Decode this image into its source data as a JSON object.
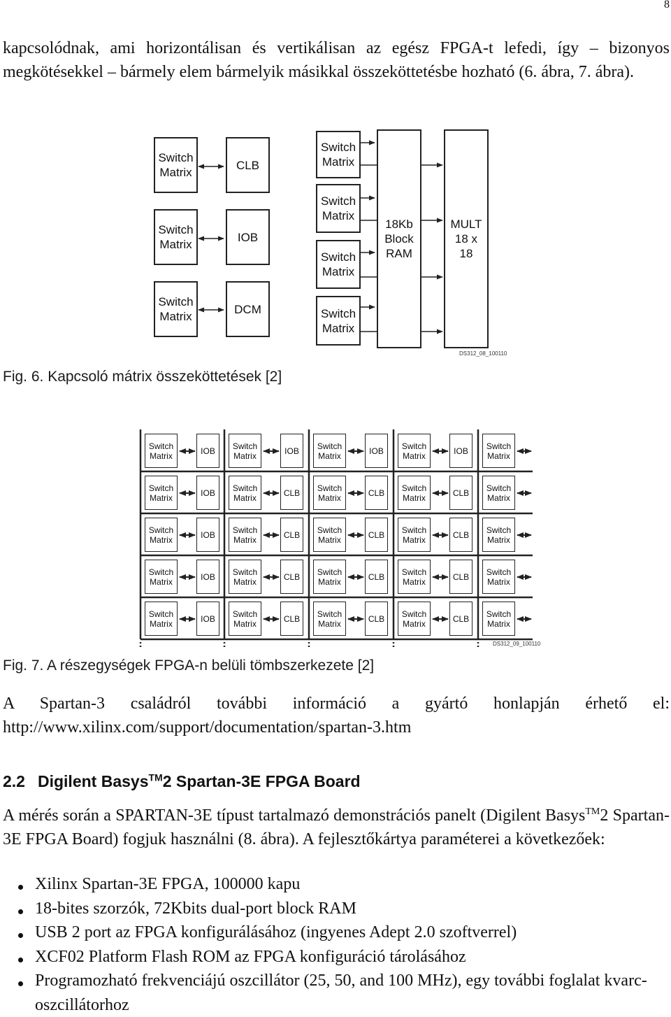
{
  "page": {
    "number": "8",
    "intro_paragraph": "kapcsolódnak, ami horizontálisan és vertikálisan az egész FPGA-t lefedi, így – bizonyos megkötésekkel – bármely elem bármelyik másikkal összeköttetésbe hozható (6. ábra, 7. ábra)."
  },
  "figure6": {
    "caption": "Fig. 6. Kapcsoló mátrix összeköttetések [2]",
    "tag": "DS312_08_100110",
    "left_pairs": [
      {
        "switch": "Switch Matrix",
        "block": "CLB"
      },
      {
        "switch": "Switch Matrix",
        "block": "IOB"
      },
      {
        "switch": "Switch Matrix",
        "block": "DCM"
      }
    ],
    "right_switches": [
      "Switch Matrix",
      "Switch Matrix",
      "Switch Matrix",
      "Switch Matrix"
    ],
    "ram_label": "18Kb Block RAM",
    "mult_label": "MULT 18 x 18"
  },
  "figure7": {
    "caption": "Fig. 7. A részegységek FPGA-n belüli tömbszerkezete [2]",
    "tag": "DS312_09_100110",
    "switch_label": "Switch Matrix",
    "rows": [
      [
        "IOB",
        "IOB",
        "IOB",
        "IOB"
      ],
      [
        "IOB",
        "CLB",
        "CLB",
        "CLB"
      ],
      [
        "IOB",
        "CLB",
        "CLB",
        "CLB"
      ],
      [
        "IOB",
        "CLB",
        "CLB",
        "CLB"
      ],
      [
        "IOB",
        "CLB",
        "CLB",
        "CLB"
      ]
    ]
  },
  "info": {
    "text": "A Spartan-3 családról további információ a gyártó honlapján érhető el:",
    "url": "http://www.xilinx.com/support/documentation/spartan-3.htm"
  },
  "section": {
    "number": "2.2",
    "title_pre": "Digilent Basys",
    "title_sup": "TM",
    "title_post": "2 Spartan-3E FPGA Board",
    "para_pre": "A mérés során a SPARTAN-3E típust tartalmazó demonstrációs panelt (Digilent Basys",
    "para_sup": "TM",
    "para_post": "2 Spartan-3E FPGA Board) fogjuk használni (8. ábra). A fejlesztőkártya paraméterei a következőek:",
    "bullets": [
      "Xilinx Spartan-3E FPGA, 100000 kapu",
      "18-bites szorzók, 72Kbits dual-port block RAM",
      "USB 2 port az FPGA konfigurálásához (ingyenes Adept 2.0 szoftverrel)",
      "XCF02 Platform Flash ROM az FPGA konfiguráció tárolásához",
      "Programozható frekvenciájú oszcillátor (25, 50, and 100 MHz), egy további foglalat kvarc- oszcillátorhoz"
    ]
  }
}
